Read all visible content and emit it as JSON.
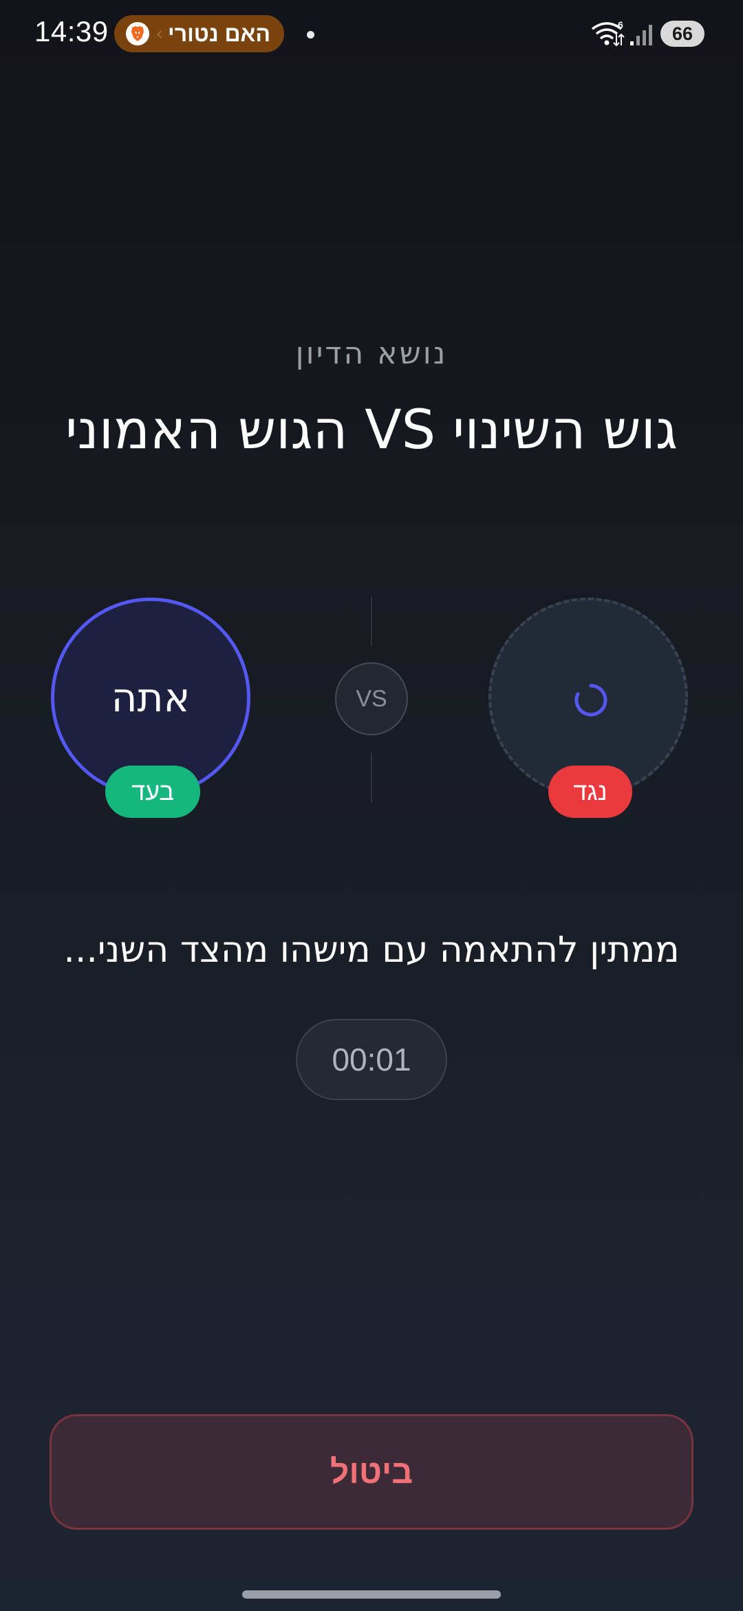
{
  "status_bar": {
    "time": "14:39",
    "browser_pill_label": "האם נטורי",
    "browser_icon": "brave-lion-icon",
    "wifi_icon": "wifi-icon",
    "signal_icon": "cellular-signal-icon",
    "battery_level": "66"
  },
  "topic": {
    "label": "נושא הדיון",
    "title": "גוש השינוי VS הגוש האמוני"
  },
  "players": {
    "you_label": "אתה",
    "for_badge": "בעד",
    "against_badge": "נגד",
    "vs_label": "VS",
    "opponent_icon": "loading-spinner-icon"
  },
  "status": {
    "waiting_text": "ממתין להתאמה עם מישהו מהצד השני...",
    "timer": "00:01"
  },
  "actions": {
    "cancel_label": "ביטול"
  },
  "colors": {
    "accent_blue": "#5457f0",
    "for_green": "#16b77e",
    "against_red": "#ea3a3e",
    "cancel_text": "#f07278"
  }
}
